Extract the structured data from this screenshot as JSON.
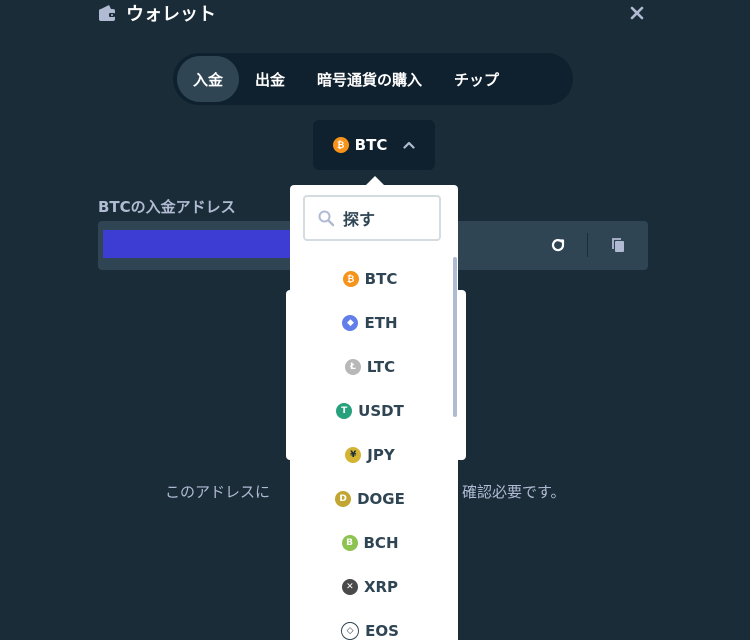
{
  "header": {
    "title": "ウォレット"
  },
  "tabs": [
    {
      "label": "入金",
      "active": true
    },
    {
      "label": "出金"
    },
    {
      "label": "暗号通貨の購入"
    },
    {
      "label": "チップ"
    }
  ],
  "currency": {
    "symbol": "BTC",
    "icon": "bitcoin-icon",
    "color": "#f7931a"
  },
  "deposit": {
    "address_label": "BTCの入金アドレス",
    "note_left": "このアドレスに",
    "note_right": "確認必要です。"
  },
  "dropdown": {
    "search_placeholder": "探す",
    "items": [
      {
        "label": "BTC",
        "icon": "bitcoin-icon",
        "glyph": "₿",
        "color": "#f7931a"
      },
      {
        "label": "ETH",
        "icon": "ethereum-icon",
        "glyph": "◆",
        "color": "#627eea"
      },
      {
        "label": "LTC",
        "icon": "litecoin-icon",
        "glyph": "Ł",
        "color": "#b8b8b8"
      },
      {
        "label": "USDT",
        "icon": "tether-icon",
        "glyph": "T",
        "color": "#26a17b"
      },
      {
        "label": "JPY",
        "icon": "yen-icon",
        "glyph": "¥",
        "color": "#d4b433"
      },
      {
        "label": "DOGE",
        "icon": "dogecoin-icon",
        "glyph": "D",
        "color": "#c2a633"
      },
      {
        "label": "BCH",
        "icon": "bitcoin-cash-icon",
        "glyph": "B",
        "color": "#8dc351"
      },
      {
        "label": "XRP",
        "icon": "xrp-icon",
        "glyph": "✕",
        "color": "#4a4a4a"
      },
      {
        "label": "EOS",
        "icon": "eos-icon",
        "glyph": "◇",
        "color": "#ffffff"
      }
    ]
  },
  "colors": {
    "background": "#1a2c38",
    "panel": "#0f212e",
    "active_tab": "#2f4553",
    "address_highlight": "#3d3dd4"
  }
}
